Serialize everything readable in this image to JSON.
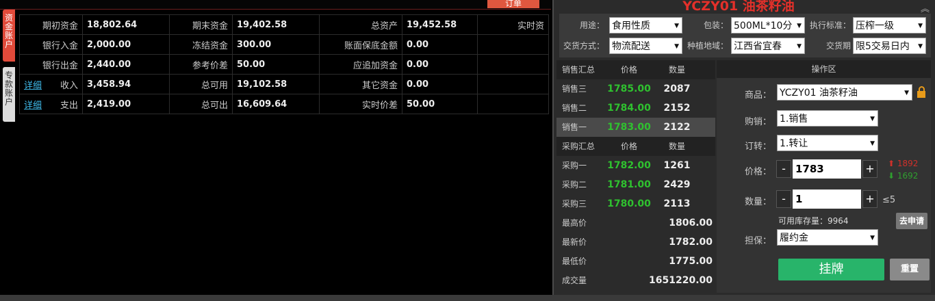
{
  "left_top": {
    "request_button": "订单"
  },
  "side_tabs": [
    {
      "label": "资金账户"
    },
    {
      "label": "专款账户"
    }
  ],
  "account": {
    "rows": [
      [
        {
          "k": "期初资金",
          "v": "18,802.64"
        },
        {
          "k": "期末资金",
          "v": "19,402.58"
        },
        {
          "k": "总资产",
          "v": "19,452.58"
        },
        {
          "k": "实时资",
          "v": ""
        }
      ],
      [
        {
          "k": "银行入金",
          "v": "2,000.00"
        },
        {
          "k": "冻结资金",
          "v": "300.00"
        },
        {
          "k": "账面保底金额",
          "v": "0.00"
        }
      ],
      [
        {
          "k": "银行出金",
          "v": "2,440.00"
        },
        {
          "k": "参考价差",
          "v": "50.00"
        },
        {
          "k": "应追加资金",
          "v": "0.00"
        }
      ],
      [
        {
          "k": "收入",
          "v": "3,458.94",
          "detail": "详细"
        },
        {
          "k": "总可用",
          "v": "19,102.58"
        },
        {
          "k": "其它资金",
          "v": "0.00"
        }
      ],
      [
        {
          "k": "支出",
          "v": "2,419.00",
          "detail": "详细"
        },
        {
          "k": "总可出",
          "v": "16,609.64"
        },
        {
          "k": "实时价差",
          "v": "50.00"
        }
      ]
    ]
  },
  "trade": {
    "title": "YCZY01 油茶籽油",
    "collapse_icon": "chevron-double-up-icon",
    "filters": {
      "usage_label": "用途：",
      "usage_value": "食用性质",
      "pack_label": "包装：",
      "pack_value": "500ML*10分",
      "standard_label": "执行标准：",
      "standard_value": "压榨一级",
      "delivery_method_label": "交货方式：",
      "delivery_method_value": "物流配送",
      "region_label": "种植地域：",
      "region_value": "江西省宜春",
      "delivery_period_label": "交货期",
      "delivery_period_value": "限5交易日内"
    },
    "book": {
      "sell_header": {
        "name": "销售汇总",
        "price": "价格",
        "qty": "数量"
      },
      "sells": [
        {
          "name": "销售三",
          "price": "1785.00",
          "qty": "2087"
        },
        {
          "name": "销售二",
          "price": "1784.00",
          "qty": "2152"
        },
        {
          "name": "销售一",
          "price": "1783.00",
          "qty": "2122"
        }
      ],
      "buy_header": {
        "name": "采购汇总",
        "price": "价格",
        "qty": "数量"
      },
      "buys": [
        {
          "name": "采购一",
          "price": "1782.00",
          "qty": "1261"
        },
        {
          "name": "采购二",
          "price": "1781.00",
          "qty": "2429"
        },
        {
          "name": "采购三",
          "price": "1780.00",
          "qty": "2113"
        }
      ],
      "stats": [
        {
          "name": "最高价",
          "value": "1806.00"
        },
        {
          "name": "最新价",
          "value": "1782.00"
        },
        {
          "name": "最低价",
          "value": "1775.00"
        },
        {
          "name": "成交量",
          "value": "1651220.00"
        }
      ]
    },
    "ops": {
      "header": "操作区",
      "product_label": "商品：",
      "product_value": "YCZY01 油茶籽油",
      "side_label": "购销：",
      "side_value": "1.销售",
      "order_label": "订转：",
      "order_value": "1.转让",
      "price_label": "价格：",
      "price_value": "1783",
      "limit_up": "1892",
      "limit_down": "1692",
      "qty_label": "数量：",
      "qty_value": "1",
      "qty_max": "≤5",
      "stock_text": "可用库存量：9964",
      "apply_button": "去申请",
      "guarantee_label": "担保：",
      "guarantee_value": "履约金",
      "post_button": "挂牌",
      "reset_button": "重置",
      "minus": "-",
      "plus": "+"
    },
    "colors": {
      "title": "#e4302a",
      "price_green": "#2fc12f",
      "post_green": "#28b46a",
      "up_red": "#d0302a"
    }
  }
}
